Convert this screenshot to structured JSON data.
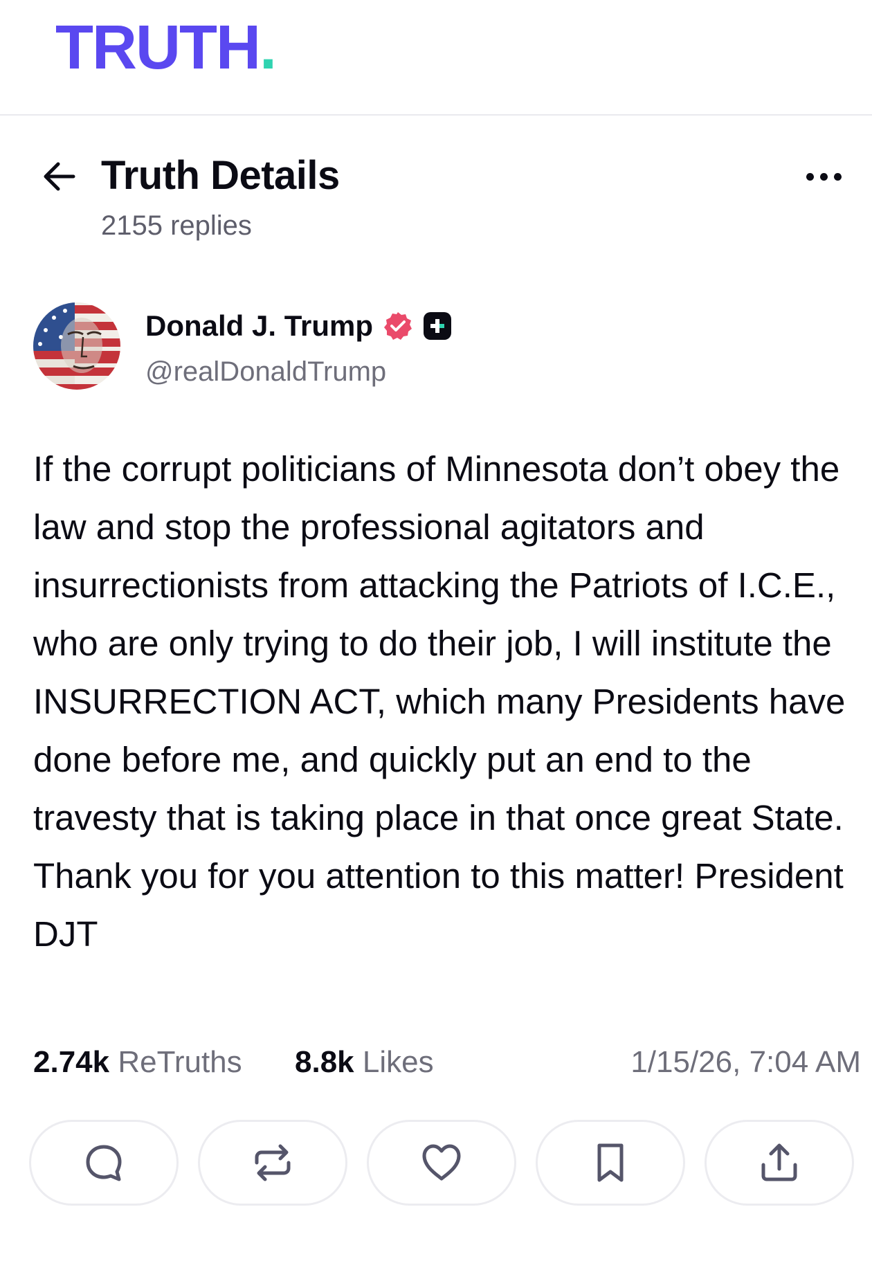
{
  "brand": {
    "logo_text": "TRUTH",
    "logo_dot": ".",
    "primary_color": "#5a48f0",
    "accent_color": "#2fd3b0"
  },
  "header": {
    "title": "Truth Details",
    "replies": "2155 replies"
  },
  "post": {
    "author_name": "Donald J. Trump",
    "author_handle": "@realDonaldTrump",
    "text": "If the corrupt politicians of Minnesota don’t obey the law and stop the professional agitators and insurrectionists from attacking the Patriots of I.C.E., who are only trying to do their job, I will institute the INSURRECTION ACT, which many Presidents have done before me, and quickly put an end to the travesty that is taking place in that once great State. Thank you for you attention to this matter! President DJT",
    "retruths_count": "2.74k",
    "retruths_label": "ReTruths",
    "likes_count": "8.8k",
    "likes_label": "Likes",
    "timestamp": "1/15/26, 7:04 AM"
  },
  "icons": {
    "back": "arrow-left-icon",
    "more": "more-horizontal-icon",
    "verified": "verified-badge-icon",
    "plus_badge": "truth-plus-badge-icon",
    "reply": "reply-bubble-icon",
    "retruth": "retruth-icon",
    "like": "heart-icon",
    "bookmark": "bookmark-icon",
    "share": "share-upload-icon"
  }
}
